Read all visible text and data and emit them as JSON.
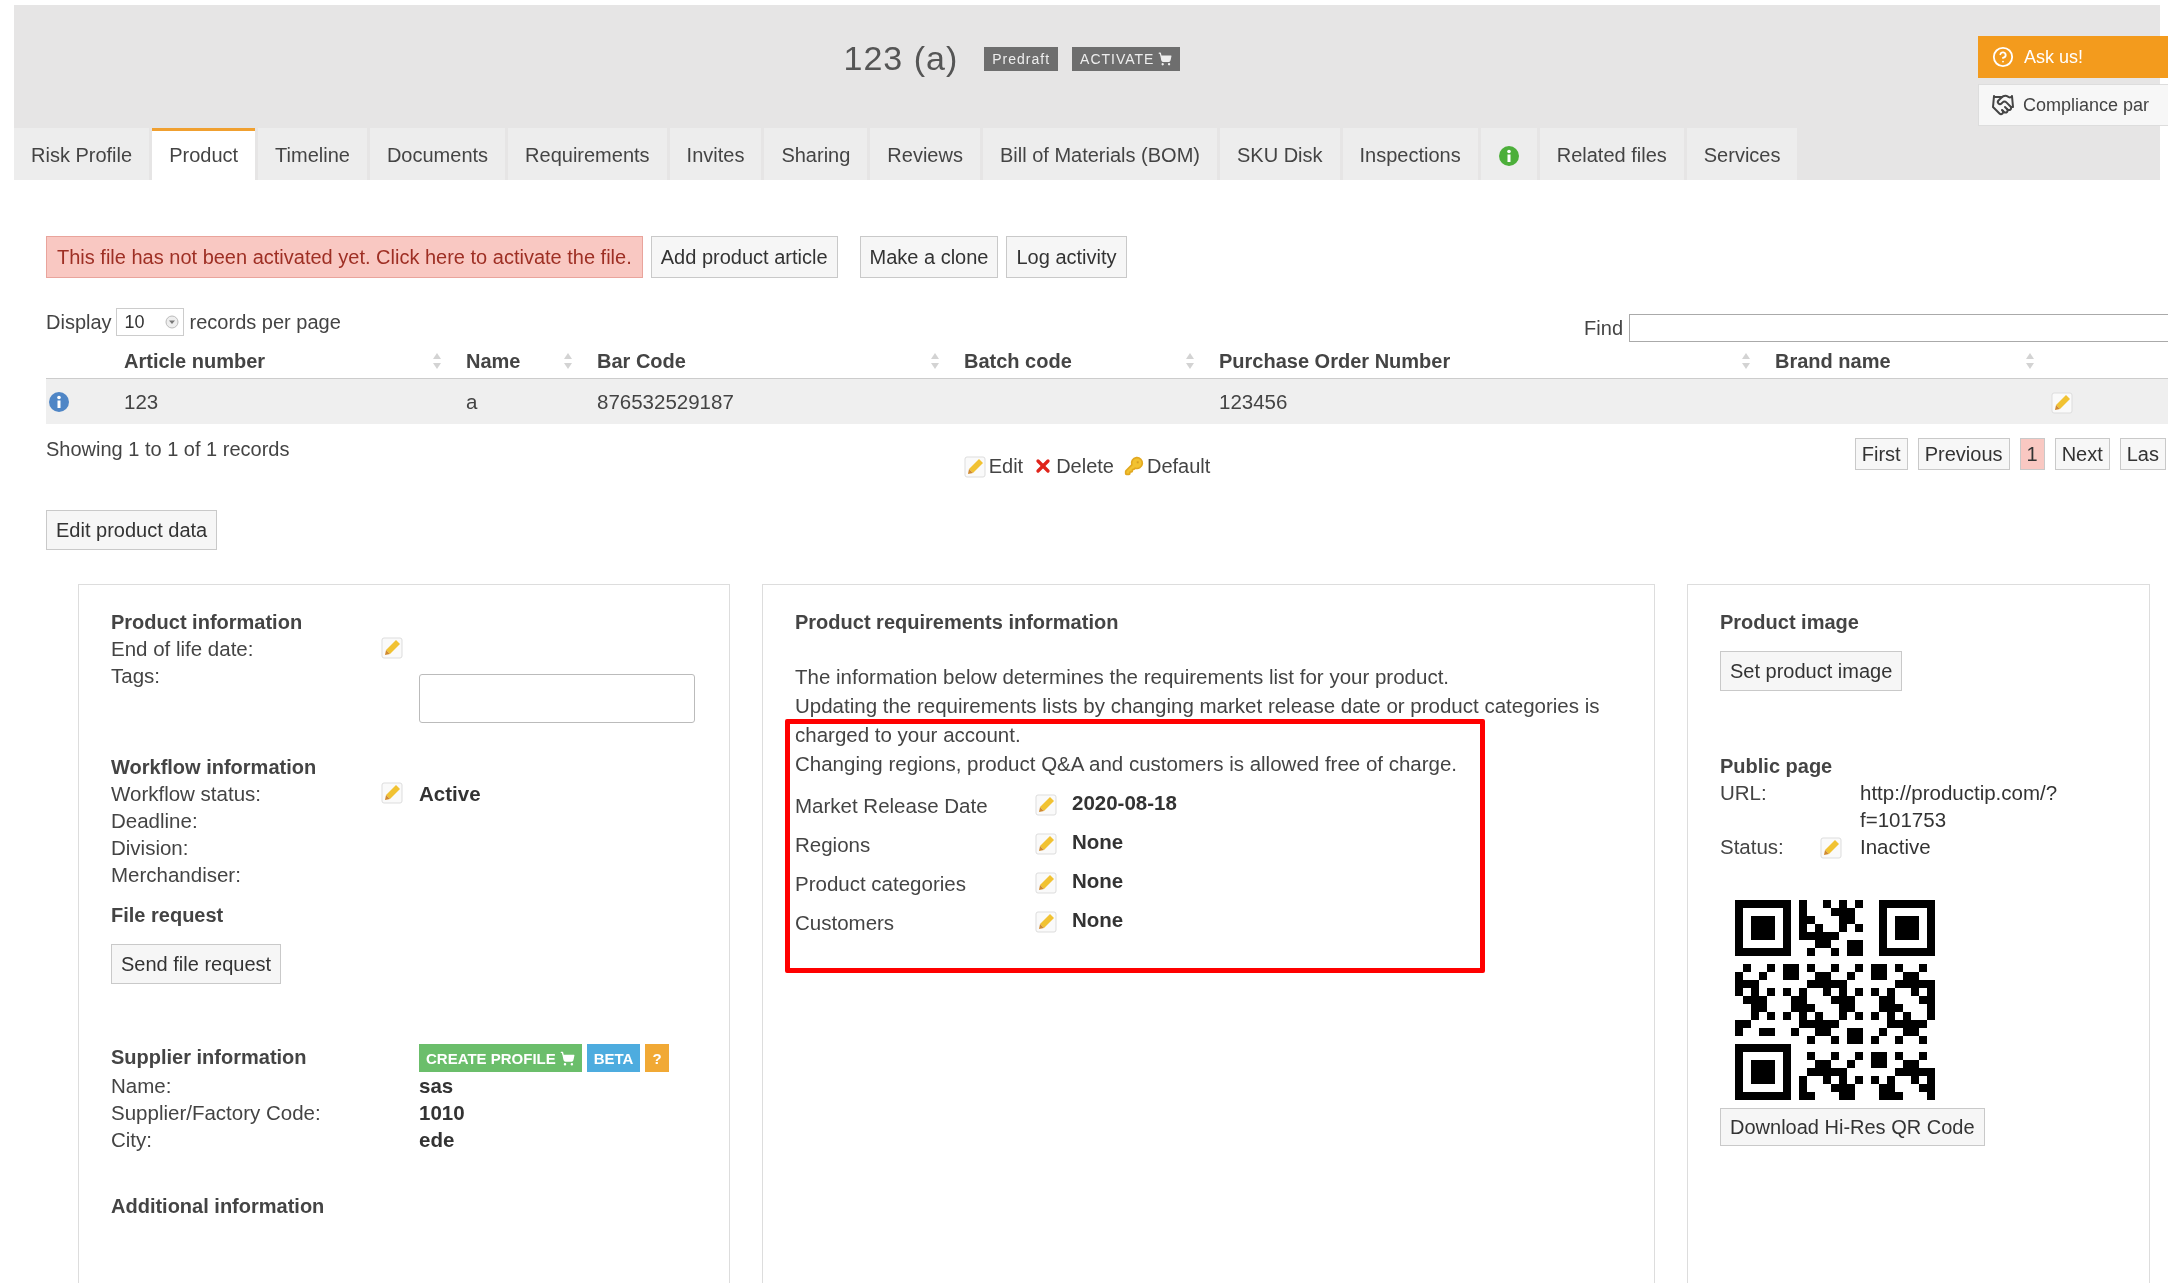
{
  "header": {
    "title": "123 (a)",
    "badges": [
      {
        "label": "Predraft",
        "kind": "plain"
      },
      {
        "label": "ACTIVATE",
        "kind": "cart"
      }
    ],
    "help_button": "Ask us!",
    "compliance_button": "Compliance par"
  },
  "tabs": [
    {
      "label": "Risk Profile",
      "kind": "text",
      "selected": false
    },
    {
      "label": "Product",
      "kind": "text",
      "selected": true
    },
    {
      "label": "Timeline",
      "kind": "text",
      "selected": false
    },
    {
      "label": "Documents",
      "kind": "text",
      "selected": false
    },
    {
      "label": "Requirements",
      "kind": "text",
      "selected": false
    },
    {
      "label": "Invites",
      "kind": "text",
      "selected": false
    },
    {
      "label": "Sharing",
      "kind": "text",
      "selected": false
    },
    {
      "label": "Reviews",
      "kind": "text",
      "selected": false
    },
    {
      "label": "Bill of Materials (BOM)",
      "kind": "text",
      "selected": false
    },
    {
      "label": "SKU Disk",
      "kind": "text",
      "selected": false
    },
    {
      "label": "Inspections",
      "kind": "text",
      "selected": false
    },
    {
      "kind": "info",
      "selected": false
    },
    {
      "label": "Related files",
      "kind": "text",
      "selected": false
    },
    {
      "label": "Services",
      "kind": "text",
      "selected": false
    }
  ],
  "actions": {
    "alert": "This file has not been activated yet. Click here to activate the file.",
    "buttons": [
      "Add product article",
      "Make a clone",
      "Log activity"
    ]
  },
  "table": {
    "display_label": "Display",
    "page_size": "10",
    "per_page_label": "records per page",
    "find_label": "Find",
    "columns": [
      "Article number",
      "Name",
      "Bar Code",
      "Batch code",
      "Purchase Order Number",
      "Brand name"
    ],
    "rows": [
      {
        "article_number": "123",
        "name": "a",
        "bar_code": "876532529187",
        "purchase_order_number": "123456"
      }
    ],
    "info": "Showing 1 to 1 of 1 records",
    "row_actions": [
      {
        "label": "Edit",
        "kind": "edit"
      },
      {
        "label": "Delete",
        "kind": "delete"
      },
      {
        "label": "Default",
        "kind": "default"
      }
    ],
    "pagination": [
      {
        "label": "First",
        "selected": false
      },
      {
        "label": "Previous",
        "selected": false
      },
      {
        "label": "1",
        "selected": true
      },
      {
        "label": "Next",
        "selected": false
      },
      {
        "label": "Las",
        "selected": false
      }
    ]
  },
  "edit_button": "Edit product data",
  "details": {
    "sections": [
      {
        "title": "Product information",
        "fields": [
          {
            "label": "End of life date:",
            "kind": "editable"
          },
          {
            "label": "Tags:",
            "kind": "input"
          }
        ]
      },
      {
        "title": "Workflow information",
        "fields": [
          {
            "label": "Workflow status:",
            "kind": "editable",
            "value": "Active"
          },
          {
            "label": "Deadline:",
            "kind": "plain"
          },
          {
            "label": "Division:",
            "kind": "plain"
          },
          {
            "label": "Merchandiser:",
            "kind": "plain"
          }
        ]
      },
      {
        "title": "File request",
        "button": "Send file request"
      },
      {
        "title": "Supplier information",
        "badges": [
          {
            "label": "CREATE PROFILE",
            "kind": "create"
          },
          {
            "label": "BETA",
            "kind": "beta"
          },
          {
            "label": "?",
            "kind": "help"
          }
        ],
        "fields": [
          {
            "label": "Name:",
            "kind": "plain",
            "value": "sas"
          },
          {
            "label": "Supplier/Factory Code:",
            "kind": "plain",
            "value": "1010"
          },
          {
            "label": "City:",
            "kind": "plain",
            "value": "ede"
          }
        ]
      },
      {
        "title": "Additional information"
      }
    ]
  },
  "requirements": {
    "title": "Product requirements information",
    "highlighted": true,
    "description": [
      "The information below determines the requirements list for your product.",
      "Updating the requirements lists by changing market release date or product categories is charged to your account.",
      "Changing regions, product Q&A and customers is allowed free of charge."
    ],
    "fields": [
      {
        "label": "Market Release Date",
        "value": "2020-08-18"
      },
      {
        "label": "Regions",
        "value": "None"
      },
      {
        "label": "Product categories",
        "value": "None"
      },
      {
        "label": "Customers",
        "value": "None"
      }
    ]
  },
  "image_panel": {
    "title": "Product image",
    "button": "Set product image",
    "public_title": "Public page",
    "url_label": "URL:",
    "url": "http://productip.com/?f=101753",
    "status_label": "Status:",
    "status": "Inactive",
    "qr_button": "Download Hi-Res QR Code"
  }
}
